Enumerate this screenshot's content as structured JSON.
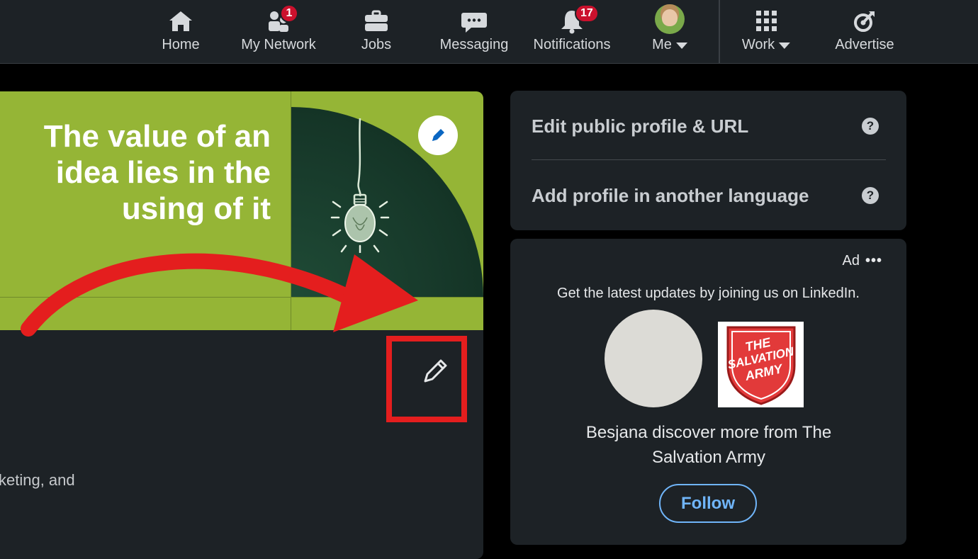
{
  "nav": {
    "items": [
      {
        "label": "Home",
        "icon": "home-icon"
      },
      {
        "label": "My Network",
        "icon": "my-network-icon",
        "badge": "1"
      },
      {
        "label": "Jobs",
        "icon": "briefcase-icon"
      },
      {
        "label": "Messaging",
        "icon": "messaging-icon"
      },
      {
        "label": "Notifications",
        "icon": "bell-icon",
        "badge": "17"
      },
      {
        "label": "Me",
        "icon": "avatar"
      },
      {
        "label": "Work",
        "icon": "grid-icon"
      },
      {
        "label": "Advertise",
        "icon": "advertise-icon"
      }
    ]
  },
  "banner": {
    "quote_line1": "The value of an",
    "quote_line2": "idea lies in the",
    "quote_line3": "using of it"
  },
  "profile": {
    "headline_fragment": "keting, and"
  },
  "side": {
    "edit_profile_label": "Edit public profile & URL",
    "add_language_label": "Add profile in another language",
    "help_glyph": "?"
  },
  "ad": {
    "label": "Ad",
    "more_glyph": "•••",
    "intro": "Get the latest updates by joining us on LinkedIn.",
    "headline_line1": "Besjana discover more from The",
    "headline_line2": "Salvation Army",
    "follow_label": "Follow",
    "logo_text_line1": "THE",
    "logo_text_line2": "SALVATION",
    "logo_text_line3": "ARMY"
  },
  "colors": {
    "nav_bg": "#1d2226",
    "card_bg": "#1d2226",
    "banner_green": "#95b536",
    "badge_red": "#cb112d",
    "annotation_red": "#e41e1e",
    "follow_blue": "#70b5f9"
  }
}
